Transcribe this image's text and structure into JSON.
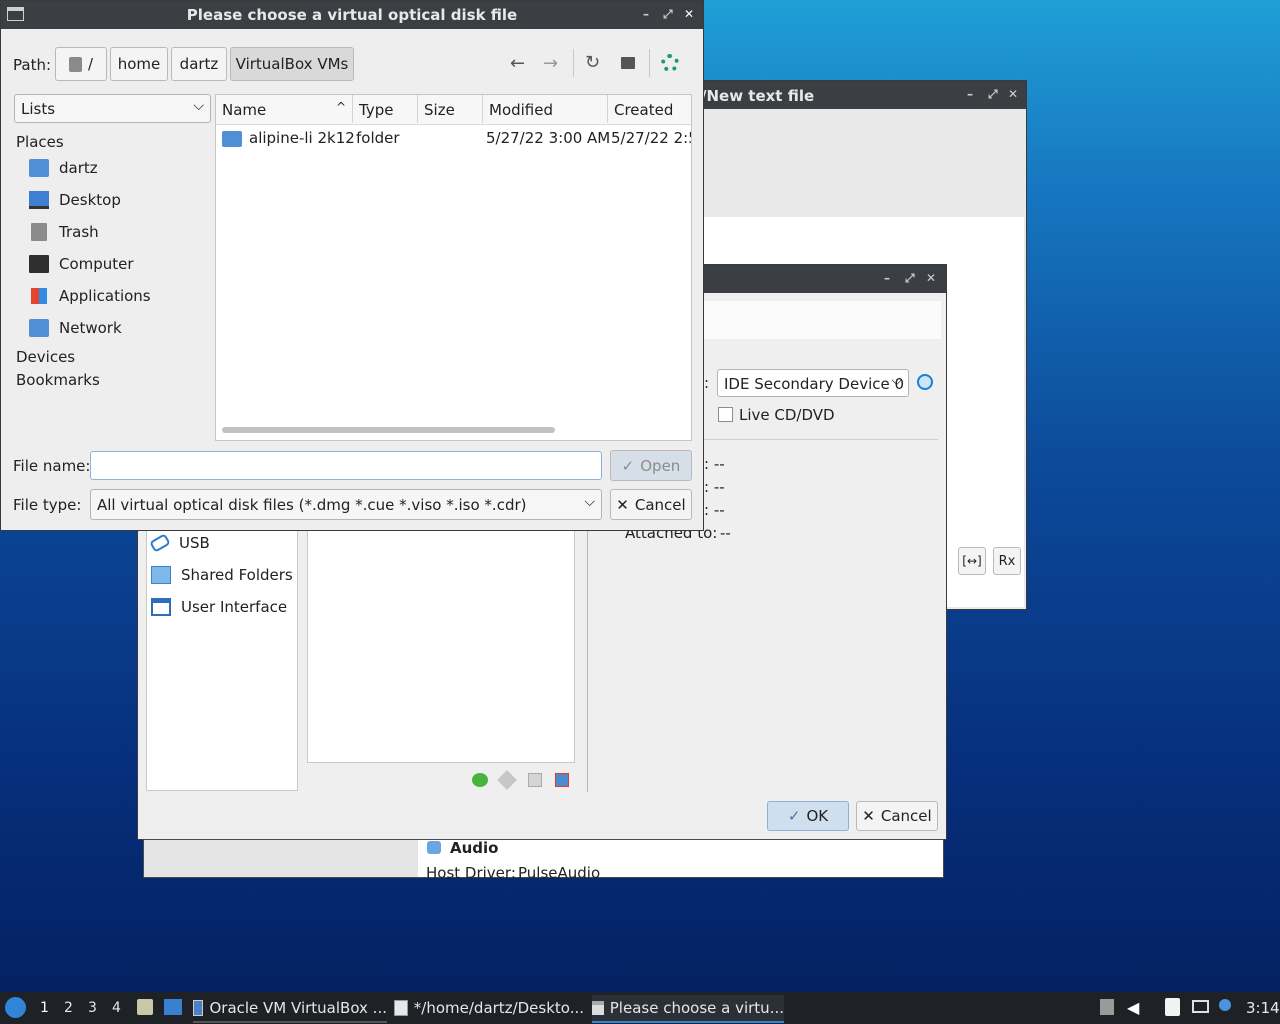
{
  "dialog": {
    "title": "Please choose a virtual optical disk file",
    "path_label": "Path:",
    "path_segments": [
      "/",
      "home",
      "dartz",
      "VirtualBox VMs"
    ],
    "side_select": "Lists",
    "places_header": "Places",
    "places": [
      "dartz",
      "Desktop",
      "Trash",
      "Computer",
      "Applications",
      "Network"
    ],
    "devices_header": "Devices",
    "bookmarks_header": "Bookmarks",
    "columns": [
      "Name",
      "Type",
      "Size",
      "Modified",
      "Created"
    ],
    "rows": [
      {
        "name": "alipine-li 2k12",
        "type": "folder",
        "size": "",
        "modified": "5/27/22 3:00 AM",
        "created": "5/27/22 2:5"
      }
    ],
    "file_name_label": "File name:",
    "file_name_value": "",
    "file_type_label": "File type:",
    "file_type_value": "All virtual optical disk files (*.dmg *.cue *.viso *.iso *.cdr)",
    "open_label": "Open",
    "cancel_label": "Cancel"
  },
  "editor_window": {
    "title": "/New text file"
  },
  "settings_dialog": {
    "controller_value": "IDE Secondary Device 0",
    "live_cd_label": "Live CD/DVD",
    "info_values": [
      ":  --",
      ":  --",
      ":  --"
    ],
    "attached_label": "Attached to:",
    "attached_value": "--",
    "sidebar": [
      "USB",
      "Shared Folders",
      "User Interface"
    ],
    "ok_label": "OK",
    "cancel_label": "Cancel"
  },
  "back_window": {
    "audio_title": "Audio",
    "host_driver_label": "Host Driver:",
    "host_driver_value": "PulseAudio"
  },
  "taskbar": {
    "workspaces": [
      "1",
      "2",
      "3",
      "4"
    ],
    "tasks": [
      "Oracle VM VirtualBox ...",
      "*/home/dartz/Deskto...",
      "Please choose a virtu..."
    ],
    "clock": "3:14"
  }
}
